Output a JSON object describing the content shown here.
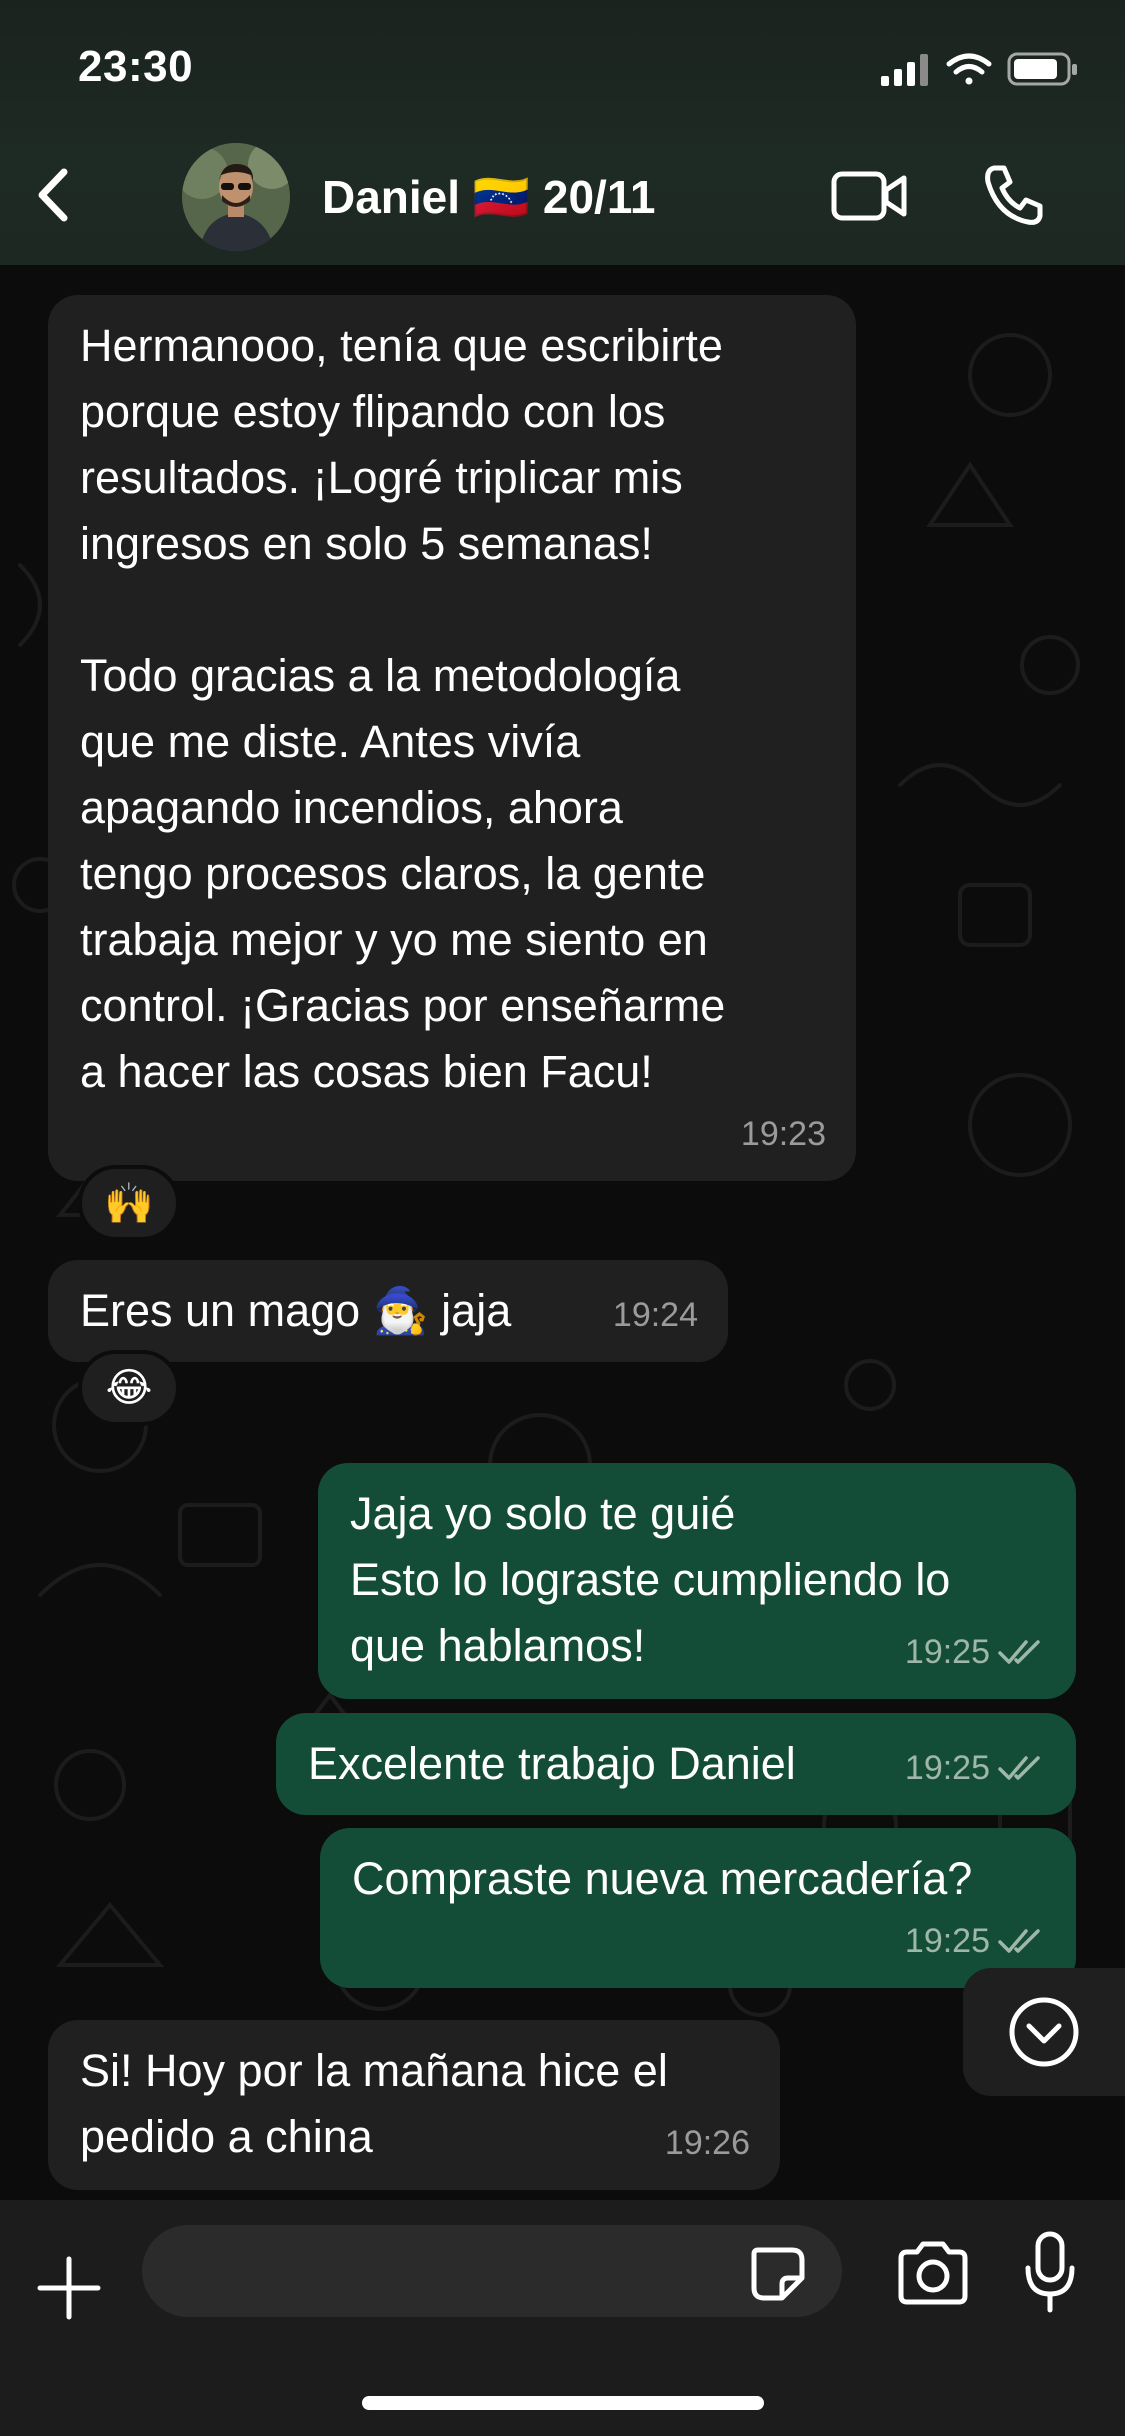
{
  "status_bar": {
    "time": "23:30"
  },
  "header": {
    "contact_name": "Daniel 🇻🇪 20/11",
    "icons": {
      "back": "chevron-left-icon",
      "video": "video-camera-icon",
      "call": "phone-icon"
    }
  },
  "messages": [
    {
      "direction": "incoming",
      "text": "Hermanooo, tenía que escribirte\nporque estoy flipando con los\nresultados. ¡Logré triplicar mis\ningresos en solo 5 semanas!\n\nTodo gracias a la metodología\nque me diste. Antes vivía\napagando incendios, ahora\ntengo procesos claros, la gente\ntrabaja mejor y yo me siento en\ncontrol. ¡Gracias por enseñarme\na hacer las cosas bien Facu!",
      "time": "19:23",
      "reaction": "🙌"
    },
    {
      "direction": "incoming",
      "text": "Eres un mago 🧙‍♂️ jaja",
      "time": "19:24",
      "reaction": "😂"
    },
    {
      "direction": "outgoing",
      "text": "Jaja yo solo te guié\nEsto lo lograste cumpliendo lo\nque hablamos!",
      "time": "19:25",
      "status": "read"
    },
    {
      "direction": "outgoing",
      "text": "Excelente trabajo Daniel",
      "time": "19:25",
      "status": "read"
    },
    {
      "direction": "outgoing",
      "text": "Compraste nueva mercadería?",
      "time": "19:25",
      "status": "read"
    },
    {
      "direction": "incoming",
      "text": "Si! Hoy por la mañana hice el\npedido a china",
      "time": "19:26"
    }
  ],
  "input_bar": {
    "placeholder": "",
    "icons": {
      "add": "plus-icon",
      "sticker": "sticker-icon",
      "camera": "camera-icon",
      "mic": "microphone-icon"
    }
  },
  "colors": {
    "incoming_bubble": "#202021",
    "outgoing_bubble": "#144d37",
    "header_bg": "#1e2a24"
  }
}
